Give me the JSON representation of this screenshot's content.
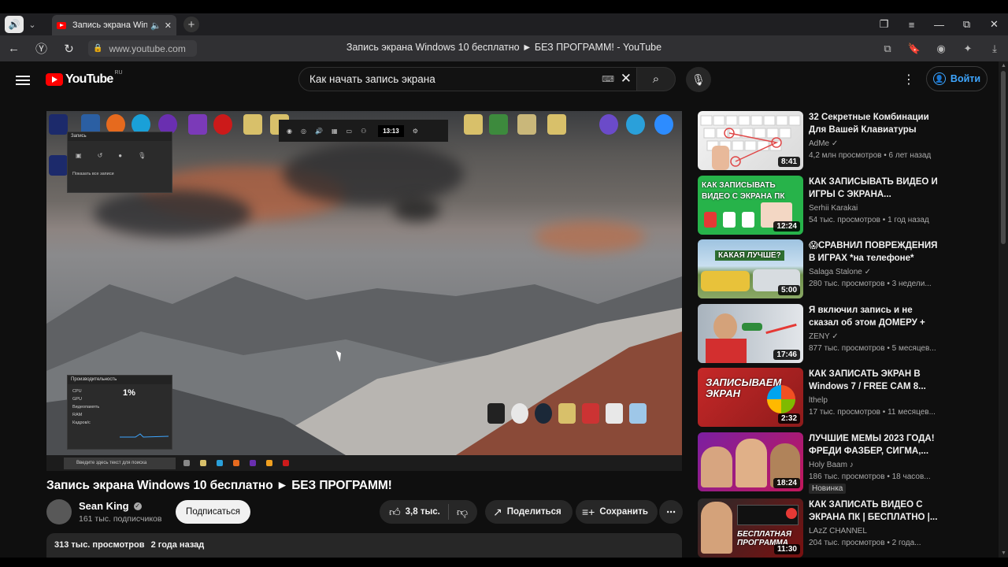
{
  "browser": {
    "tab_title": "Запись экрана Windows 10 бесплатно",
    "url": "www.youtube.com",
    "page_title": "Запись экрана Windows 10 бесплатно ► БЕЗ ПРОГРАММ! - YouTube"
  },
  "header": {
    "logo_text": "YouTube",
    "logo_region": "RU",
    "search_value": "Как начать запись экрана",
    "signin_label": "Войти"
  },
  "player": {
    "gamebar_time": "13:13",
    "recording_panel_title": "Запись",
    "recording_panel_link": "Показать все записи",
    "perf_panel_title": "Производительность",
    "perf_cpu_label": "CPU",
    "perf_cpu_value": "1%",
    "perf_gpu_label": "GPU",
    "perf_vram_label": "Видеопамять",
    "perf_ram_label": "RAM",
    "perf_fps_label": "Кадров/с",
    "taskbar_search": "Введите здесь текст для поиска"
  },
  "video": {
    "title": "Запись экрана Windows 10 бесплатно ► БЕЗ ПРОГРАММ!",
    "channel": "Sean King",
    "subscribers": "161 тыс. подписчиков",
    "subscribe_label": "Подписаться",
    "likes": "3,8 тыс.",
    "share_label": "Поделиться",
    "save_label": "Сохранить",
    "views": "313 тыс. просмотров",
    "age": "2 года назад"
  },
  "recommendations": [
    {
      "title": "32 Секретные Комбинации Для Вашей Клавиатуры",
      "channel": "AdMe",
      "verified": true,
      "views": "4,2 млн просмотров",
      "age": "6 лет назад",
      "duration": "8:41"
    },
    {
      "title": "КАК ЗАПИСЫВАТЬ ВИДЕО И ИГРЫ С ЭКРАНА...",
      "channel": "Serhii Karakai",
      "verified": false,
      "views": "54 тыс. просмотров",
      "age": "1 год назад",
      "duration": "12:24",
      "thumb_text": "КАК ЗАПИСЫВАТЬ ВИДЕО С ЭКРАНА ПК"
    },
    {
      "title": "😱СРАВНИЛ ПОВРЕЖДЕНИЯ В ИГРАХ *на телефоне*",
      "channel": "Salaga Stalone",
      "verified": true,
      "views": "280 тыс. просмотров",
      "age": "3 недели...",
      "duration": "5:00",
      "thumb_text": "КАКАЯ ЛУЧШЕ?"
    },
    {
      "title": "Я включил запись и не сказал об этом ДОМЕРУ + ВЕБКА",
      "channel": "ZENY",
      "verified": true,
      "views": "877 тыс. просмотров",
      "age": "5 месяцев...",
      "duration": "17:46"
    },
    {
      "title": "КАК ЗАПИСАТЬ ЭКРАН В Windows 7 / FREE CAM 8...",
      "channel": "lthelp",
      "verified": false,
      "views": "17 тыс. просмотров",
      "age": "11 месяцев...",
      "duration": "2:32",
      "thumb_text": "ЗАПИСЫВАЕМ ЭКРАН"
    },
    {
      "title": "ЛУЧШИЕ МЕМЫ 2023 ГОДА! ФРЕДИ ФАЗБЕР, СИГМА,...",
      "channel": "Holy Baam",
      "verified": false,
      "views": "186 тыс. просмотров",
      "age": "18 часов...",
      "duration": "18:24",
      "badge": "Новинка"
    },
    {
      "title": "КАК ЗАПИСАТЬ ВИДЕО С ЭКРАНА ПК | БЕСПЛАТНО |...",
      "channel": "LAzZ CHANNEL",
      "verified": false,
      "views": "204 тыс. просмотров",
      "age": "2 года...",
      "duration": "11:30",
      "thumb_text": "БЕСПЛАТНАЯ ПРОГРАММА"
    }
  ],
  "colors": {
    "accent": "#3ea6ff",
    "brand_red": "#ff0000",
    "background": "#0f0f0f"
  }
}
